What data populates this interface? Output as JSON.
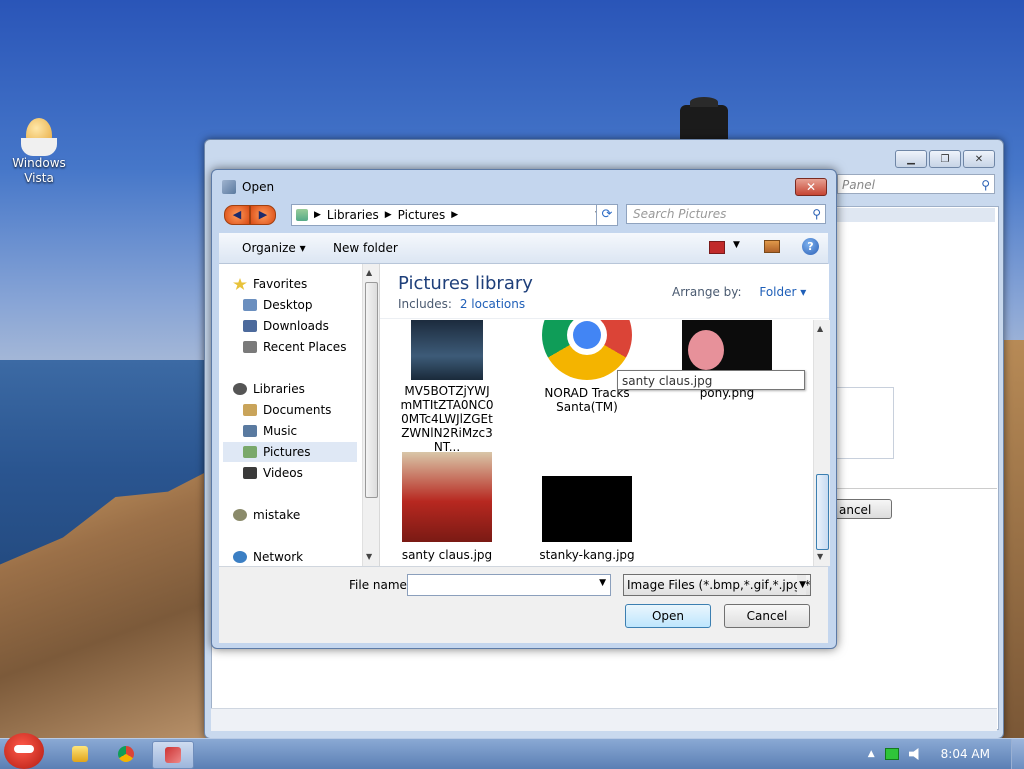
{
  "desktop": {
    "icon_label": "Windows Vista"
  },
  "background_window": {
    "search_placeholder": "Panel",
    "cancel_label": "ancel"
  },
  "dialog": {
    "title": "Open",
    "close_label": "✕",
    "breadcrumb": [
      "Libraries",
      "Pictures"
    ],
    "search_placeholder": "Search Pictures",
    "toolbar": {
      "organize": "Organize ▾",
      "new_folder": "New folder",
      "help": "?"
    },
    "nav": [
      {
        "label": "Favorites",
        "group": true
      },
      {
        "label": "Desktop"
      },
      {
        "label": "Downloads"
      },
      {
        "label": "Recent Places"
      },
      {
        "label": "Libraries",
        "group": true
      },
      {
        "label": "Documents"
      },
      {
        "label": "Music"
      },
      {
        "label": "Pictures",
        "selected": true
      },
      {
        "label": "Videos"
      },
      {
        "label": "mistake",
        "group": true
      },
      {
        "label": "Network",
        "group": true
      }
    ],
    "library": {
      "title": "Pictures library",
      "includes_label": "Includes:",
      "locations": "2 locations",
      "arrange_label": "Arrange by:",
      "arrange_value": "Folder ▾"
    },
    "files": [
      {
        "name": "MV5BOTZjYWJmMTItZTA0NC00MTc4LWJlZGEtZWNlN2RiMzc3NT..."
      },
      {
        "name": "NORAD Tracks Santa(TM)"
      },
      {
        "name": "pony.png"
      },
      {
        "name": "santy claus.jpg"
      },
      {
        "name": "stanky-kang.jpg"
      }
    ],
    "tooltip": "santy claus.jpg",
    "file_name_label": "File name:",
    "file_name_value": "",
    "file_type": "Image Files (*.bmp,*.gif,*.jpg,*.",
    "open_button": "Open",
    "cancel_button": "Cancel"
  },
  "taskbar": {
    "clock": "8:04 AM"
  },
  "colors": {
    "accent": "#1e3f7a",
    "link": "#1f5fb8",
    "selection": "#dfe8f5"
  }
}
